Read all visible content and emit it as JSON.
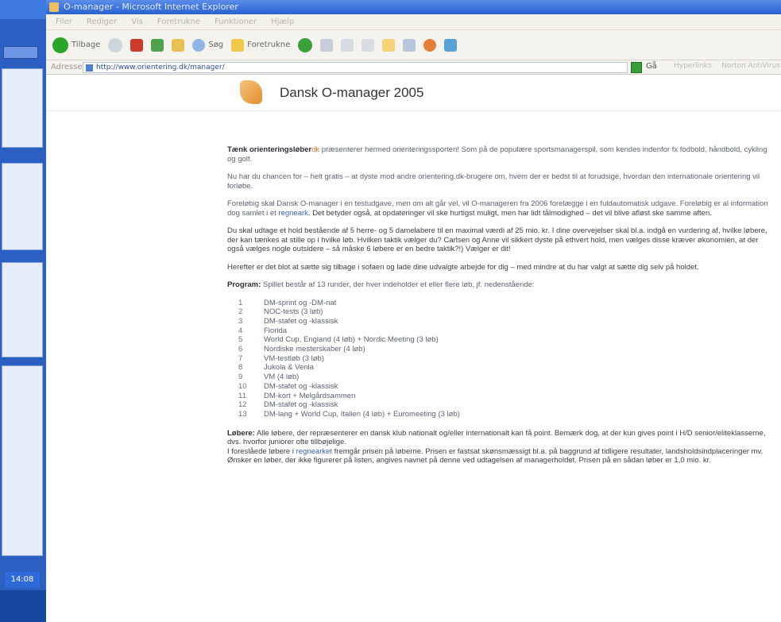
{
  "window": {
    "title": "O-manager - Microsoft Internet Explorer"
  },
  "menu": [
    "Filer",
    "Rediger",
    "Vis",
    "Foretrukne",
    "Funktioner",
    "Hjælp"
  ],
  "toolbar": {
    "back_label": "Tilbage",
    "search_label": "Søg",
    "favorites_label": "Foretrukne"
  },
  "address": {
    "label": "Adresse",
    "url": "http://www.orientering.dk/manager/",
    "go_label": "Gå",
    "links_label": "Hyperlinks",
    "extra": "Norton AntiVirus"
  },
  "header": {
    "title": "Dansk O-manager 2005"
  },
  "intro": {
    "bold": "Tænk orienteringsløber",
    "highlight": "dk",
    "rest": " præsenterer hermed orienteringssporten! Som på de populære sportsmanagerspil, som kendes indenfor fx fodbold, håndbold, cykling og golf."
  },
  "p2": "Nu har du chancen for – helt gratis – at dyste mod andre orientering.dk-brugere om, hvem der er bedst til at forudsige, hvordan den internationale orientering vil forløbe.",
  "p3": {
    "a": "Foreløbig skal Dansk O-manager i en testudgave, men om alt går vel, vil O-manageren fra 2006 forelægge i en fuldautomatisk udgave. Foreløbig er al information dog samlet i et ",
    "link": "regneark",
    "b": ". Det betyder også, at opdateringer vil ske hurtigst muligt, men har lidt tålmodighed – det vil blive afløst ske samme aften."
  },
  "p4": "Du skal udtage et hold bestående af 5 herre- og 5 damelabere til en maximal værdi af 25 mio. kr. I dine overvejelser skal bl.a. indgå en vurdering af, hvilke løbere, der kan tænkes at stille op i hvilke løb. Hvilken taktik vælger du? Carlsen og Anne vil sikkert dyste på ethvert hold, men vælges disse kræver økonomien, at der også vælges nogle outsidere – så måske 6 løbere er en bedre taktik?!) Vælger er dit!",
  "p5": "Herefter er det blot at sætte sig tilbage i sofaen og lade dine udvalgte arbejde for dig – med mindre at du har valgt at sætte dig selv på holdet.",
  "program": {
    "bold": "Program:",
    "text": " Spillet består af 13 runder, der hver indeholder et eller flere løb, jf. nedenstående:",
    "items": [
      {
        "n": "1",
        "t": "DM-sprint og -DM-nat"
      },
      {
        "n": "2",
        "t": "NOC-tests (3 løb)"
      },
      {
        "n": "3",
        "t": "DM-stafet og -klassisk"
      },
      {
        "n": "4",
        "t": "Florida"
      },
      {
        "n": "5",
        "t": "World Cup, England (4 løb) + Nordic Meeting (3 løb)"
      },
      {
        "n": "6",
        "t": "Nordiske mesterskaber (4 løb)"
      },
      {
        "n": "7",
        "t": "VM-testløb (3 løb)"
      },
      {
        "n": "8",
        "t": "Jukola & Venla"
      },
      {
        "n": "9",
        "t": "VM (4 løb)"
      },
      {
        "n": "10",
        "t": "DM-stafet og -klassisk"
      },
      {
        "n": "11",
        "t": "DM-kort + Melgårdsammen"
      },
      {
        "n": "12",
        "t": "DM-stafet og -klassisk"
      },
      {
        "n": "13",
        "t": "DM-lang + World Cup, Italien (4 løb) + Euromeeting (3 løb)"
      }
    ]
  },
  "loebere": {
    "bold": "Løbere:",
    "a": " Alle løbere, der repræsenterer en dansk klub nationalt og/eller internationalt kan få point. Bemærk dog, at der kun gives point i H/D senior/eliteklasserne, dvs. hvorfor juniorer ofte tillbøjelige.",
    "b": "I foreslåede løbere i ",
    "link": "regnearket",
    "c": " fremgår prisen på løberne. Prisen er fastsat skønsmæssigt bl.a. på baggrund af tidligere resultater, landsholdsindplaceringer mv. Ønsker en løber, der ikke figurerer på listen, angives navnet på denne ved udtagelsen af managerholdet. Prisen på en sådan løber er 1,0 mio. kr."
  },
  "taskbar": {
    "clock": "14:08"
  }
}
